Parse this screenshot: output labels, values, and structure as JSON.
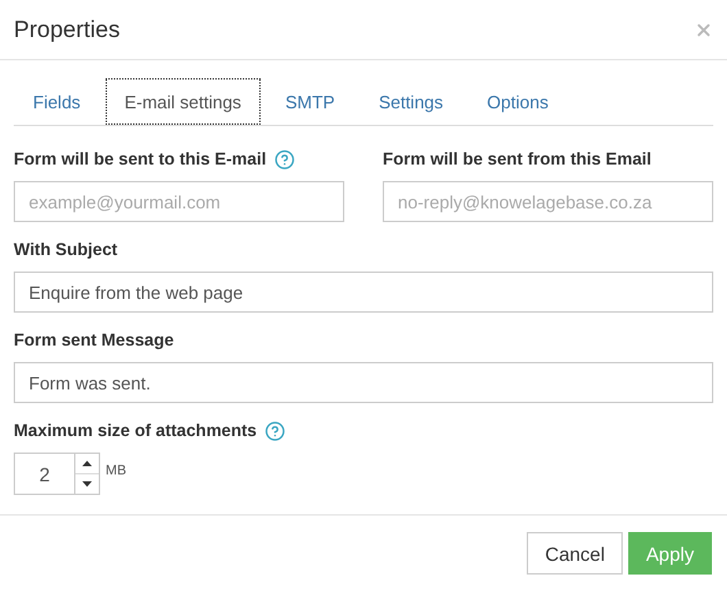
{
  "window": {
    "title": "Properties"
  },
  "tabs": [
    {
      "label": "Fields",
      "selected": false
    },
    {
      "label": "E-mail settings",
      "selected": true
    },
    {
      "label": "SMTP",
      "selected": false
    },
    {
      "label": "Settings",
      "selected": false
    },
    {
      "label": "Options",
      "selected": false
    }
  ],
  "email_row": [
    {
      "label": "Form will be sent to this E-mail",
      "help": true,
      "placeholder": "example@yourmail.com"
    },
    {
      "label": "Form will be sent from this Email",
      "help": false,
      "placeholder": "no-reply@knowelagebase.co.za"
    }
  ],
  "fields": [
    {
      "label": "With Subject",
      "value": "Enquire from the web page"
    },
    {
      "label": "Form sent Message",
      "value": "Form was sent."
    }
  ],
  "attachments": {
    "label": "Maximum size of attachments",
    "help": true,
    "value": "2",
    "unit": "MB"
  },
  "buttons": [
    {
      "label": "Cancel",
      "kind": "default"
    },
    {
      "label": "Apply",
      "kind": "primary"
    }
  ]
}
